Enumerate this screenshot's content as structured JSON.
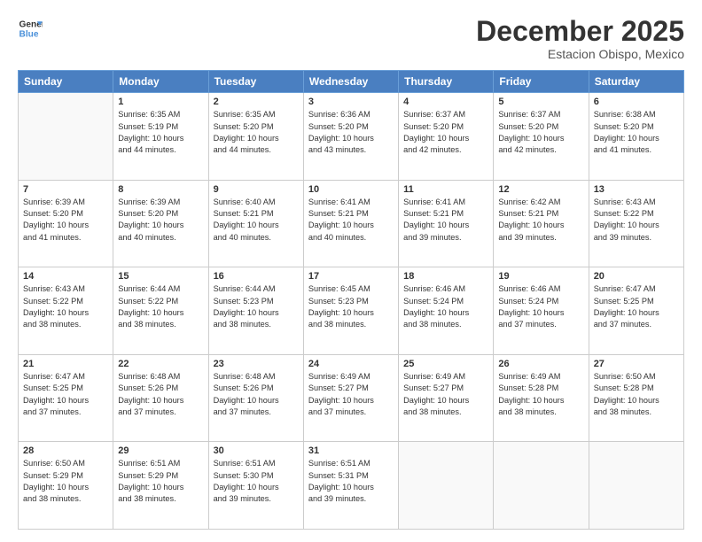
{
  "logo": {
    "line1": "General",
    "line2": "Blue"
  },
  "title": "December 2025",
  "location": "Estacion Obispo, Mexico",
  "headers": [
    "Sunday",
    "Monday",
    "Tuesday",
    "Wednesday",
    "Thursday",
    "Friday",
    "Saturday"
  ],
  "weeks": [
    [
      {
        "day": "",
        "content": ""
      },
      {
        "day": "1",
        "content": "Sunrise: 6:35 AM\nSunset: 5:19 PM\nDaylight: 10 hours\nand 44 minutes."
      },
      {
        "day": "2",
        "content": "Sunrise: 6:35 AM\nSunset: 5:20 PM\nDaylight: 10 hours\nand 44 minutes."
      },
      {
        "day": "3",
        "content": "Sunrise: 6:36 AM\nSunset: 5:20 PM\nDaylight: 10 hours\nand 43 minutes."
      },
      {
        "day": "4",
        "content": "Sunrise: 6:37 AM\nSunset: 5:20 PM\nDaylight: 10 hours\nand 42 minutes."
      },
      {
        "day": "5",
        "content": "Sunrise: 6:37 AM\nSunset: 5:20 PM\nDaylight: 10 hours\nand 42 minutes."
      },
      {
        "day": "6",
        "content": "Sunrise: 6:38 AM\nSunset: 5:20 PM\nDaylight: 10 hours\nand 41 minutes."
      }
    ],
    [
      {
        "day": "7",
        "content": "Sunrise: 6:39 AM\nSunset: 5:20 PM\nDaylight: 10 hours\nand 41 minutes."
      },
      {
        "day": "8",
        "content": "Sunrise: 6:39 AM\nSunset: 5:20 PM\nDaylight: 10 hours\nand 40 minutes."
      },
      {
        "day": "9",
        "content": "Sunrise: 6:40 AM\nSunset: 5:21 PM\nDaylight: 10 hours\nand 40 minutes."
      },
      {
        "day": "10",
        "content": "Sunrise: 6:41 AM\nSunset: 5:21 PM\nDaylight: 10 hours\nand 40 minutes."
      },
      {
        "day": "11",
        "content": "Sunrise: 6:41 AM\nSunset: 5:21 PM\nDaylight: 10 hours\nand 39 minutes."
      },
      {
        "day": "12",
        "content": "Sunrise: 6:42 AM\nSunset: 5:21 PM\nDaylight: 10 hours\nand 39 minutes."
      },
      {
        "day": "13",
        "content": "Sunrise: 6:43 AM\nSunset: 5:22 PM\nDaylight: 10 hours\nand 39 minutes."
      }
    ],
    [
      {
        "day": "14",
        "content": "Sunrise: 6:43 AM\nSunset: 5:22 PM\nDaylight: 10 hours\nand 38 minutes."
      },
      {
        "day": "15",
        "content": "Sunrise: 6:44 AM\nSunset: 5:22 PM\nDaylight: 10 hours\nand 38 minutes."
      },
      {
        "day": "16",
        "content": "Sunrise: 6:44 AM\nSunset: 5:23 PM\nDaylight: 10 hours\nand 38 minutes."
      },
      {
        "day": "17",
        "content": "Sunrise: 6:45 AM\nSunset: 5:23 PM\nDaylight: 10 hours\nand 38 minutes."
      },
      {
        "day": "18",
        "content": "Sunrise: 6:46 AM\nSunset: 5:24 PM\nDaylight: 10 hours\nand 38 minutes."
      },
      {
        "day": "19",
        "content": "Sunrise: 6:46 AM\nSunset: 5:24 PM\nDaylight: 10 hours\nand 37 minutes."
      },
      {
        "day": "20",
        "content": "Sunrise: 6:47 AM\nSunset: 5:25 PM\nDaylight: 10 hours\nand 37 minutes."
      }
    ],
    [
      {
        "day": "21",
        "content": "Sunrise: 6:47 AM\nSunset: 5:25 PM\nDaylight: 10 hours\nand 37 minutes."
      },
      {
        "day": "22",
        "content": "Sunrise: 6:48 AM\nSunset: 5:26 PM\nDaylight: 10 hours\nand 37 minutes."
      },
      {
        "day": "23",
        "content": "Sunrise: 6:48 AM\nSunset: 5:26 PM\nDaylight: 10 hours\nand 37 minutes."
      },
      {
        "day": "24",
        "content": "Sunrise: 6:49 AM\nSunset: 5:27 PM\nDaylight: 10 hours\nand 37 minutes."
      },
      {
        "day": "25",
        "content": "Sunrise: 6:49 AM\nSunset: 5:27 PM\nDaylight: 10 hours\nand 38 minutes."
      },
      {
        "day": "26",
        "content": "Sunrise: 6:49 AM\nSunset: 5:28 PM\nDaylight: 10 hours\nand 38 minutes."
      },
      {
        "day": "27",
        "content": "Sunrise: 6:50 AM\nSunset: 5:28 PM\nDaylight: 10 hours\nand 38 minutes."
      }
    ],
    [
      {
        "day": "28",
        "content": "Sunrise: 6:50 AM\nSunset: 5:29 PM\nDaylight: 10 hours\nand 38 minutes."
      },
      {
        "day": "29",
        "content": "Sunrise: 6:51 AM\nSunset: 5:29 PM\nDaylight: 10 hours\nand 38 minutes."
      },
      {
        "day": "30",
        "content": "Sunrise: 6:51 AM\nSunset: 5:30 PM\nDaylight: 10 hours\nand 39 minutes."
      },
      {
        "day": "31",
        "content": "Sunrise: 6:51 AM\nSunset: 5:31 PM\nDaylight: 10 hours\nand 39 minutes."
      },
      {
        "day": "",
        "content": ""
      },
      {
        "day": "",
        "content": ""
      },
      {
        "day": "",
        "content": ""
      }
    ]
  ]
}
